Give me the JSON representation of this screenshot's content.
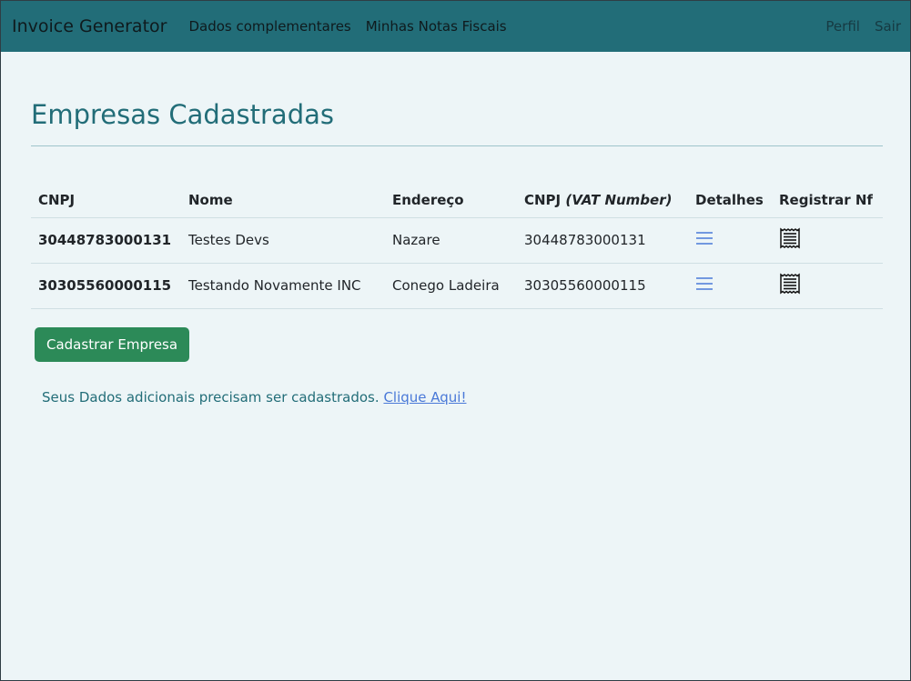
{
  "navbar": {
    "brand": "Invoice Generator",
    "links": [
      {
        "label": "Dados complementares"
      },
      {
        "label": "Minhas Notas Fiscais"
      }
    ],
    "right_links": [
      {
        "label": "Perfil"
      },
      {
        "label": "Sair"
      }
    ]
  },
  "page": {
    "title": "Empresas Cadastradas"
  },
  "table": {
    "headers": {
      "cnpj": "CNPJ",
      "nome": "Nome",
      "endereco": "Endereço",
      "cnpj_vat_prefix": "CNPJ",
      "cnpj_vat_suffix": "(VAT Number)",
      "detalhes": "Detalhes",
      "registrar": "Registrar Nf"
    },
    "rows": [
      {
        "cnpj": "30448783000131",
        "nome": "Testes Devs",
        "endereco": "Nazare",
        "vat": "30448783000131",
        "detalhes_icon": "list-icon",
        "registrar_icon": "receipt-icon"
      },
      {
        "cnpj": "30305560000115",
        "nome": "Testando Novamente INC",
        "endereco": "Conego Ladeira",
        "vat": "30305560000115",
        "detalhes_icon": "list-icon",
        "registrar_icon": "receipt-icon"
      }
    ]
  },
  "actions": {
    "cadastrar_label": "Cadastrar Empresa"
  },
  "notice": {
    "text": "Seus Dados adicionais precisam ser cadastrados.",
    "link": "Clique Aqui!"
  },
  "colors": {
    "navbar_bg": "#226d78",
    "page_bg": "#edf5f7",
    "title": "#226d78",
    "button_bg": "#2c8a58",
    "link": "#4a79d8",
    "list_icon": "#4a79d8"
  }
}
